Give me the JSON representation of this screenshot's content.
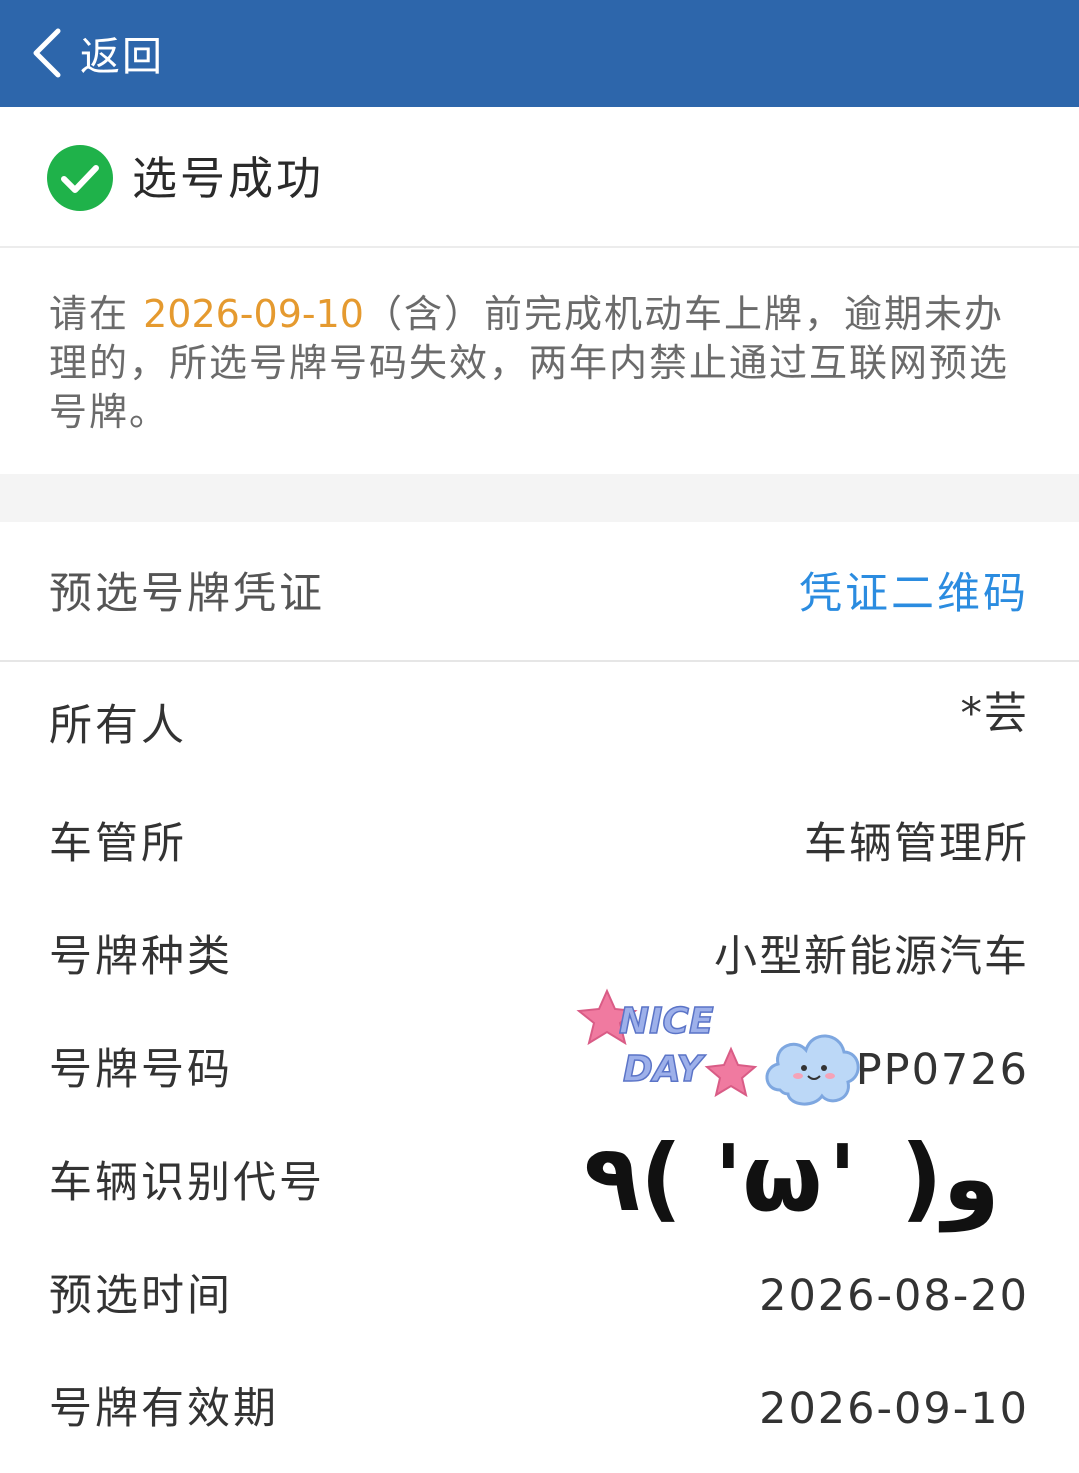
{
  "header": {
    "back_label": "返回",
    "title": "",
    "background": "#2d66ab"
  },
  "status": {
    "icon": "check-circle-icon",
    "icon_color": "#1fb24a",
    "text": "选号成功"
  },
  "notice": {
    "prefix": "请在 ",
    "date": "2026-09-10",
    "suffix": "（含）前完成机动车上牌，逾期未办理的，所选号牌号码失效，两年内禁止通过互联网预选号牌。",
    "date_color": "#e59a2f"
  },
  "certificate": {
    "label": "预选号牌凭证",
    "link": "凭证二维码",
    "link_color": "#2b8ce0"
  },
  "details": [
    {
      "label": "所有人",
      "value": "*芸"
    },
    {
      "label": "车管所",
      "value": "车辆管理所"
    },
    {
      "label": "号牌种类",
      "value": "小型新能源汽车"
    },
    {
      "label": "号牌号码",
      "value": "PP0726"
    },
    {
      "label": "车辆识别代号",
      "value": ""
    },
    {
      "label": "预选时间",
      "value": "2026-08-20"
    },
    {
      "label": "号牌有效期",
      "value": "2026-09-10"
    }
  ],
  "stickers": {
    "nice_line1": "NICE",
    "nice_line2": "DAY",
    "kaomoji": "٩( 'ω' )و"
  }
}
